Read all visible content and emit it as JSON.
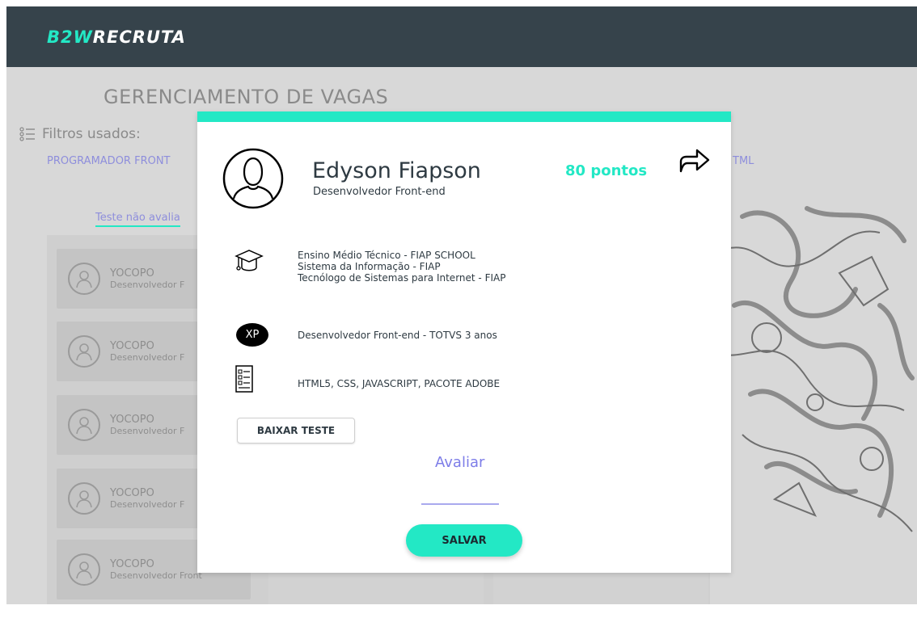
{
  "app": {
    "logo_prefix": "B2W",
    "logo_suffix": "RECRUTA",
    "accent": "#23e8c5",
    "header_bg": "#36434b"
  },
  "page": {
    "title": "GERENCIAMENTO DE VAGAS"
  },
  "filters": {
    "label": "Filtros usados:",
    "chips": [
      "PROGRAMADOR FRONT",
      "TML"
    ]
  },
  "tabs": {
    "unrated": "Teste não avalia"
  },
  "candidates": [
    {
      "name": "YOCOPO",
      "role": "Desenvolvedor F"
    },
    {
      "name": "YOCOPO",
      "role": "Desenvolvedor F"
    },
    {
      "name": "YOCOPO",
      "role": "Desenvolvedor F"
    },
    {
      "name": "YOCOPO",
      "role": "Desenvolvedor F"
    },
    {
      "name": "YOCOPO",
      "role": "Desenvolvedor Front"
    }
  ],
  "modal": {
    "name": "Edyson Fiapson",
    "role": "Desenvolvedor Front-end",
    "score": "80 pontos",
    "education": [
      "Ensino Médio Técnico - FIAP SCHOOL",
      "Sistema da Informação - FIAP",
      "Tecnólogo de Sistemas para Internet - FIAP"
    ],
    "experience_badge": "XP",
    "experience": "Desenvolvedor Front-end - TOTVS 3 anos",
    "skills": "HTML5, CSS, JAVASCRIPT, PACOTE ADOBE",
    "download_label": "BAIXAR TESTE",
    "evaluate_label": "Avaliar",
    "evaluate_value": "",
    "save_label": "SALVAR",
    "icons": {
      "avatar": "user-avatar-icon",
      "share": "share-icon",
      "education": "graduation-cap-icon",
      "skills": "checklist-icon"
    }
  }
}
